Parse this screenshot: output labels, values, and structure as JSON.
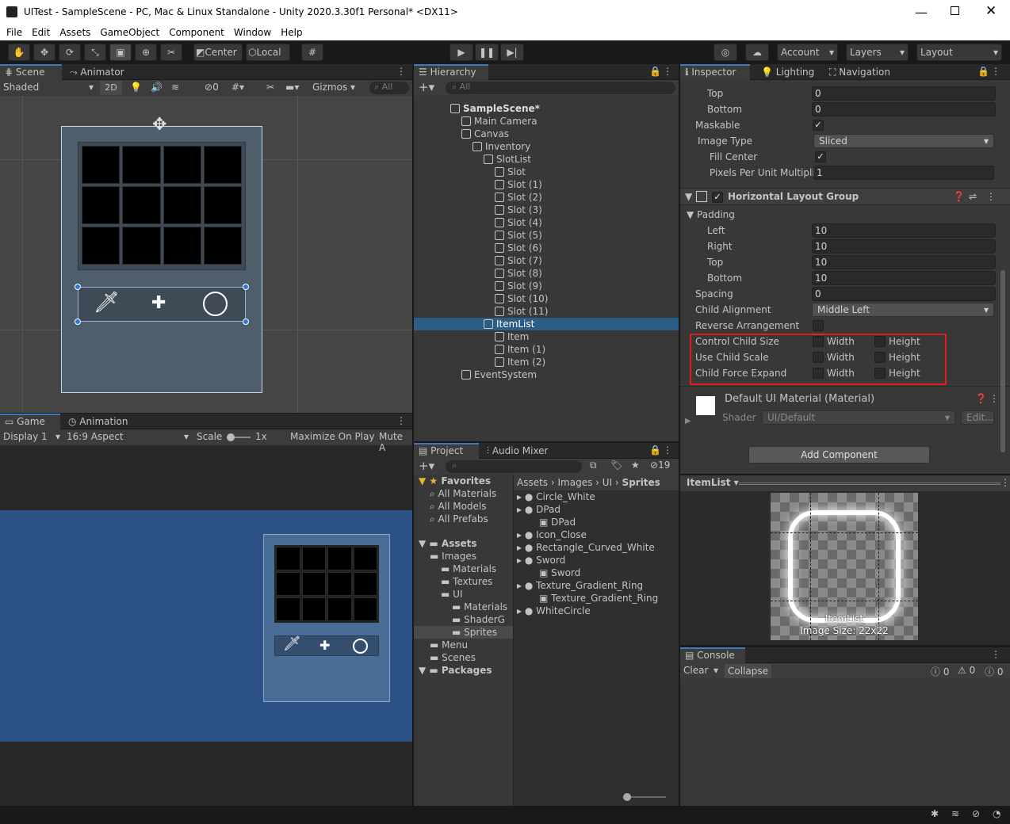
{
  "window": {
    "title": "UITest - SampleScene - PC, Mac & Linux Standalone - Unity 2020.3.30f1 Personal* <DX11>"
  },
  "menu": [
    "File",
    "Edit",
    "Assets",
    "GameObject",
    "Component",
    "Window",
    "Help"
  ],
  "toolbar": {
    "center": "Center",
    "local": "Local",
    "account": "Account",
    "layers": "Layers",
    "layout": "Layout"
  },
  "scene": {
    "tab_scene": "Scene",
    "tab_animator": "Animator",
    "shading": "Shaded",
    "mode2d": "2D",
    "hidden_count": "0",
    "gizmos": "Gizmos",
    "search_placeholder": "All"
  },
  "game": {
    "tab_game": "Game",
    "tab_animation": "Animation",
    "display": "Display 1",
    "aspect": "16:9 Aspect",
    "scale_label": "Scale",
    "scale_value": "1x",
    "maximize": "Maximize On Play",
    "mute": "Mute A"
  },
  "hierarchy": {
    "tab": "Hierarchy",
    "search_placeholder": "All",
    "items": [
      {
        "label": "SampleScene*",
        "depth": 0
      },
      {
        "label": "Main Camera",
        "depth": 1
      },
      {
        "label": "Canvas",
        "depth": 1
      },
      {
        "label": "Inventory",
        "depth": 2
      },
      {
        "label": "SlotList",
        "depth": 3
      },
      {
        "label": "Slot",
        "depth": 4
      },
      {
        "label": "Slot (1)",
        "depth": 4
      },
      {
        "label": "Slot (2)",
        "depth": 4
      },
      {
        "label": "Slot (3)",
        "depth": 4
      },
      {
        "label": "Slot (4)",
        "depth": 4
      },
      {
        "label": "Slot (5)",
        "depth": 4
      },
      {
        "label": "Slot (6)",
        "depth": 4
      },
      {
        "label": "Slot (7)",
        "depth": 4
      },
      {
        "label": "Slot (8)",
        "depth": 4
      },
      {
        "label": "Slot (9)",
        "depth": 4
      },
      {
        "label": "Slot (10)",
        "depth": 4
      },
      {
        "label": "Slot (11)",
        "depth": 4
      },
      {
        "label": "ItemList",
        "depth": 3,
        "selected": true
      },
      {
        "label": "Item",
        "depth": 4
      },
      {
        "label": "Item (1)",
        "depth": 4
      },
      {
        "label": "Item (2)",
        "depth": 4
      },
      {
        "label": "EventSystem",
        "depth": 1
      }
    ]
  },
  "project": {
    "tab_project": "Project",
    "tab_audio": "Audio Mixer",
    "hidden_count": "19",
    "tree": [
      {
        "label": "Favorites",
        "depth": 0,
        "bold": true
      },
      {
        "label": "All Materials",
        "depth": 1
      },
      {
        "label": "All Models",
        "depth": 1
      },
      {
        "label": "All Prefabs",
        "depth": 1
      },
      {
        "label": "Assets",
        "depth": 0,
        "bold": true
      },
      {
        "label": "Images",
        "depth": 1
      },
      {
        "label": "Materials",
        "depth": 2
      },
      {
        "label": "Textures",
        "depth": 2
      },
      {
        "label": "UI",
        "depth": 2
      },
      {
        "label": "Materials",
        "depth": 3
      },
      {
        "label": "ShaderG",
        "depth": 3
      },
      {
        "label": "Sprites",
        "depth": 3,
        "selected": true
      },
      {
        "label": "Menu",
        "depth": 1
      },
      {
        "label": "Scenes",
        "depth": 1
      },
      {
        "label": "Packages",
        "depth": 0,
        "bold": true
      }
    ],
    "breadcrumb": [
      "Assets",
      "Images",
      "UI",
      "Sprites"
    ],
    "files": [
      {
        "label": "Circle_White",
        "depth": 0
      },
      {
        "label": "DPad",
        "depth": 0
      },
      {
        "label": "DPad",
        "depth": 1
      },
      {
        "label": "Icon_Close",
        "depth": 0
      },
      {
        "label": "Rectangle_Curved_White",
        "depth": 0
      },
      {
        "label": "Sword",
        "depth": 0
      },
      {
        "label": "Sword",
        "depth": 1
      },
      {
        "label": "Texture_Gradient_Ring",
        "depth": 0
      },
      {
        "label": "Texture_Gradient_Ring",
        "depth": 1
      },
      {
        "label": "WhiteCircle",
        "depth": 0
      }
    ]
  },
  "inspector": {
    "tab_inspector": "Inspector",
    "tab_lighting": "Lighting",
    "tab_navigation": "Navigation",
    "top_label": "Top",
    "top_value": "0",
    "bottom_label": "Bottom",
    "bottom_value": "0",
    "maskable": "Maskable",
    "image_type": "Image Type",
    "image_type_value": "Sliced",
    "fill_center": "Fill Center",
    "ppu": "Pixels Per Unit Multiplie",
    "ppu_value": "1",
    "hlg_title": "Horizontal Layout Group",
    "padding": "Padding",
    "left": "Left",
    "left_v": "10",
    "right": "Right",
    "right_v": "10",
    "ptop": "Top",
    "ptop_v": "10",
    "pbottom": "Bottom",
    "pbottom_v": "10",
    "spacing": "Spacing",
    "spacing_v": "0",
    "child_alignment": "Child Alignment",
    "child_alignment_v": "Middle Left",
    "reverse": "Reverse Arrangement",
    "ccs": "Control Child Size",
    "ucs": "Use Child Scale",
    "cfe": "Child Force Expand",
    "width": "Width",
    "height": "Height",
    "material": "Default UI Material (Material)",
    "shader": "Shader",
    "shader_v": "UI/Default",
    "edit": "Edit...",
    "add_component": "Add Component"
  },
  "preview": {
    "object": "ItemList",
    "name": "ItemList",
    "size": "Image Size: 22x22"
  },
  "console": {
    "tab": "Console",
    "clear": "Clear",
    "collapse": "Collapse",
    "errors": "0",
    "warnings": "0",
    "logs": "0"
  },
  "colors": {
    "selection": "#2c5d87",
    "accent": "#3a79bb",
    "highlight": "#e21d1d",
    "game_bg": "#2d5288"
  }
}
